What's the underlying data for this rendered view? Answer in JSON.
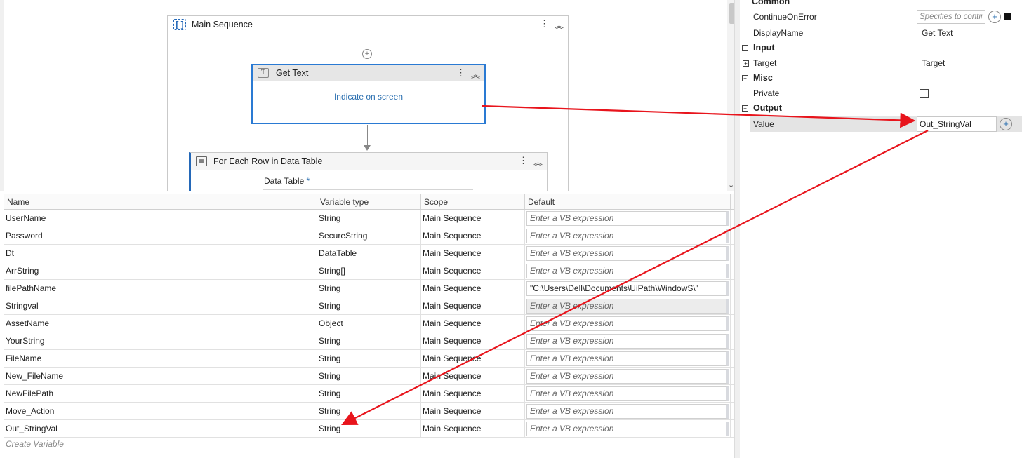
{
  "designer": {
    "sequence_title": "Main Sequence",
    "get_text": {
      "title": "Get Text",
      "indicate_label": "Indicate on screen"
    },
    "for_each": {
      "title": "For Each Row in Data Table",
      "data_table_label": "Data Table",
      "required_marker": "*"
    }
  },
  "variables": {
    "headers": {
      "name": "Name",
      "type": "Variable type",
      "scope": "Scope",
      "default": "Default"
    },
    "placeholder": "Enter a VB expression",
    "create_label": "Create Variable",
    "rows": [
      {
        "name": "UserName",
        "type": "String",
        "scope": "Main Sequence",
        "default": "Enter a VB expression"
      },
      {
        "name": "Password",
        "type": "SecureString",
        "scope": "Main Sequence",
        "default": "Enter a VB expression"
      },
      {
        "name": "Dt",
        "type": "DataTable",
        "scope": "Main Sequence",
        "default": "Enter a VB expression"
      },
      {
        "name": "ArrString",
        "type": "String[]",
        "scope": "Main Sequence",
        "default": "Enter a VB expression"
      },
      {
        "name": "filePathName",
        "type": "String",
        "scope": "Main Sequence",
        "default": "\"C:\\Users\\Dell\\Documents\\UiPath\\WindowS\\\""
      },
      {
        "name": "Stringval",
        "type": "String",
        "scope": "Main Sequence",
        "default": "Enter a VB expression"
      },
      {
        "name": "AssetName",
        "type": "Object",
        "scope": "Main Sequence",
        "default": "Enter a VB expression"
      },
      {
        "name": "YourString",
        "type": "String",
        "scope": "Main Sequence",
        "default": "Enter a VB expression"
      },
      {
        "name": "FileName",
        "type": "String",
        "scope": "Main Sequence",
        "default": "Enter a VB expression"
      },
      {
        "name": "New_FileName",
        "type": "String",
        "scope": "Main Sequence",
        "default": "Enter a VB expression"
      },
      {
        "name": "NewFilePath",
        "type": "String",
        "scope": "Main Sequence",
        "default": "Enter a VB expression"
      },
      {
        "name": "Move_Action",
        "type": "String",
        "scope": "Main Sequence",
        "default": "Enter a VB expression"
      },
      {
        "name": "Out_StringVal",
        "type": "String",
        "scope": "Main Sequence",
        "default": "Enter a VB expression"
      }
    ]
  },
  "properties": {
    "common": {
      "label": "Common",
      "continue_on_error": {
        "label": "ContinueOnError",
        "placeholder": "Specifies to contir"
      },
      "display_name": {
        "label": "DisplayName",
        "value": "Get Text"
      }
    },
    "input": {
      "label": "Input",
      "target": {
        "label": "Target",
        "value": "Target"
      }
    },
    "misc": {
      "label": "Misc",
      "private": {
        "label": "Private"
      }
    },
    "output": {
      "label": "Output",
      "value": {
        "label": "Value",
        "value": "Out_StringVal"
      }
    }
  },
  "colors": {
    "annotation_arrow": "#e8141c",
    "selection_border": "#2a7ad3"
  }
}
